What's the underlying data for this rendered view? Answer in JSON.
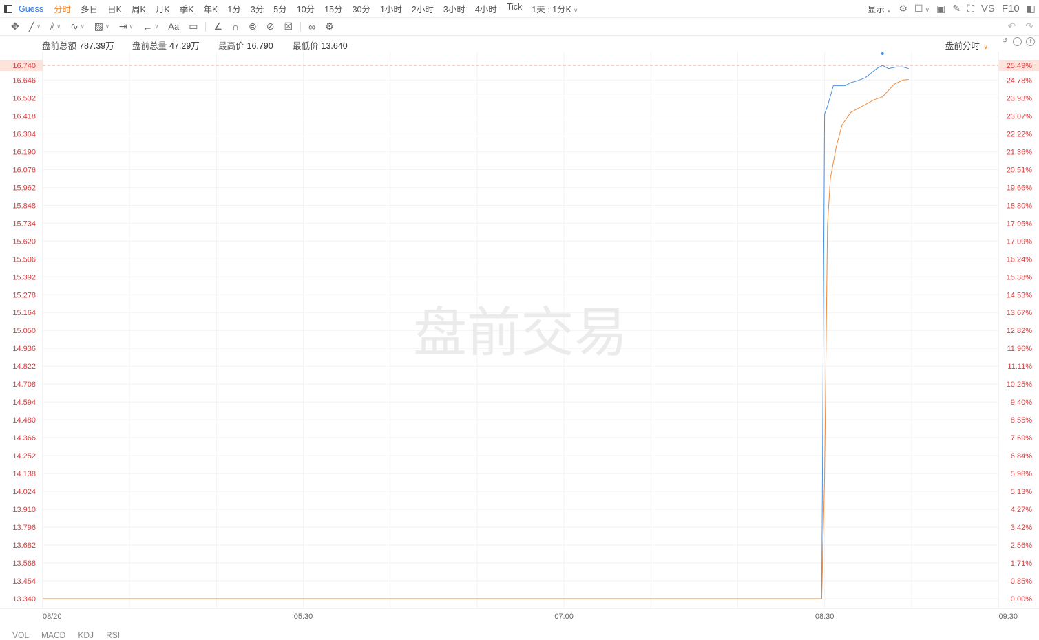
{
  "header": {
    "symbol": "Guess",
    "periods": [
      "分时",
      "多日",
      "日K",
      "周K",
      "月K",
      "季K",
      "年K",
      "1分",
      "3分",
      "5分",
      "10分",
      "15分",
      "30分",
      "1小时",
      "2小时",
      "3小时",
      "4小时",
      "Tick"
    ],
    "active_period": "分时",
    "period_combo": "1天 : 1分K",
    "display_label": "显示",
    "vs_label": "VS",
    "f10_label": "F10"
  },
  "stats": {
    "turnover_label": "盘前总额",
    "turnover_value": "787.39万",
    "volume_label": "盘前总量",
    "volume_value": "47.29万",
    "high_label": "最高价",
    "high_value": "16.790",
    "low_label": "最低价",
    "low_value": "13.640",
    "mode_label": "盘前分时"
  },
  "watermark": "盘前交易",
  "bottom_tabs": [
    "VOL",
    "MACD",
    "KDJ",
    "RSI"
  ],
  "colors": {
    "price_line": "#4a90e2",
    "avg_line": "#f0883a",
    "axis_text": "#e03c3c",
    "ref_line": "#f2a48c"
  },
  "chart_data": {
    "type": "line",
    "price_ticks": [
      "16.740",
      "16.646",
      "16.532",
      "16.418",
      "16.304",
      "16.190",
      "16.076",
      "15.962",
      "15.848",
      "15.734",
      "15.620",
      "15.506",
      "15.392",
      "15.278",
      "15.164",
      "15.050",
      "14.936",
      "14.822",
      "14.708",
      "14.594",
      "14.480",
      "14.366",
      "14.252",
      "14.138",
      "14.024",
      "13.910",
      "13.796",
      "13.682",
      "13.568",
      "13.454",
      "13.340"
    ],
    "pct_ticks": [
      "25.49%",
      "24.78%",
      "23.93%",
      "23.07%",
      "22.22%",
      "21.36%",
      "20.51%",
      "19.66%",
      "18.80%",
      "17.95%",
      "17.09%",
      "16.24%",
      "15.38%",
      "14.53%",
      "13.67%",
      "12.82%",
      "11.96%",
      "11.11%",
      "10.25%",
      "9.40%",
      "8.55%",
      "7.69%",
      "6.84%",
      "5.98%",
      "5.13%",
      "4.27%",
      "3.42%",
      "2.56%",
      "1.71%",
      "0.85%",
      "0.00%"
    ],
    "x_ticks": [
      "08/20",
      "05:30",
      "07:00",
      "08:30",
      "09:30"
    ],
    "x_domain": [
      "04:00",
      "09:30"
    ],
    "ylim": [
      13.34,
      16.74
    ],
    "current_price": 16.74,
    "series": [
      {
        "points": [
          [
            "04:00",
            13.34
          ],
          [
            "08:29",
            13.34
          ],
          [
            "08:30",
            16.43
          ],
          [
            "08:31",
            16.48
          ],
          [
            "08:33",
            16.61
          ],
          [
            "08:37",
            16.61
          ],
          [
            "08:39",
            16.63
          ],
          [
            "08:41",
            16.64
          ],
          [
            "08:44",
            16.66
          ],
          [
            "08:46",
            16.69
          ],
          [
            "08:48",
            16.72
          ],
          [
            "08:50",
            16.74
          ],
          [
            "08:52",
            16.72
          ],
          [
            "08:55",
            16.73
          ],
          [
            "08:57",
            16.73
          ],
          [
            "08:59",
            16.72
          ]
        ]
      },
      {
        "points": [
          [
            "04:00",
            13.34
          ],
          [
            "08:29",
            13.34
          ],
          [
            "08:30",
            14.12
          ],
          [
            "08:31",
            15.72
          ],
          [
            "08:32",
            16.02
          ],
          [
            "08:34",
            16.22
          ],
          [
            "08:36",
            16.36
          ],
          [
            "08:39",
            16.44
          ],
          [
            "08:43",
            16.48
          ],
          [
            "08:47",
            16.52
          ],
          [
            "08:50",
            16.54
          ],
          [
            "08:52",
            16.58
          ],
          [
            "08:54",
            16.62
          ],
          [
            "08:57",
            16.646
          ],
          [
            "08:59",
            16.65
          ]
        ]
      }
    ]
  }
}
